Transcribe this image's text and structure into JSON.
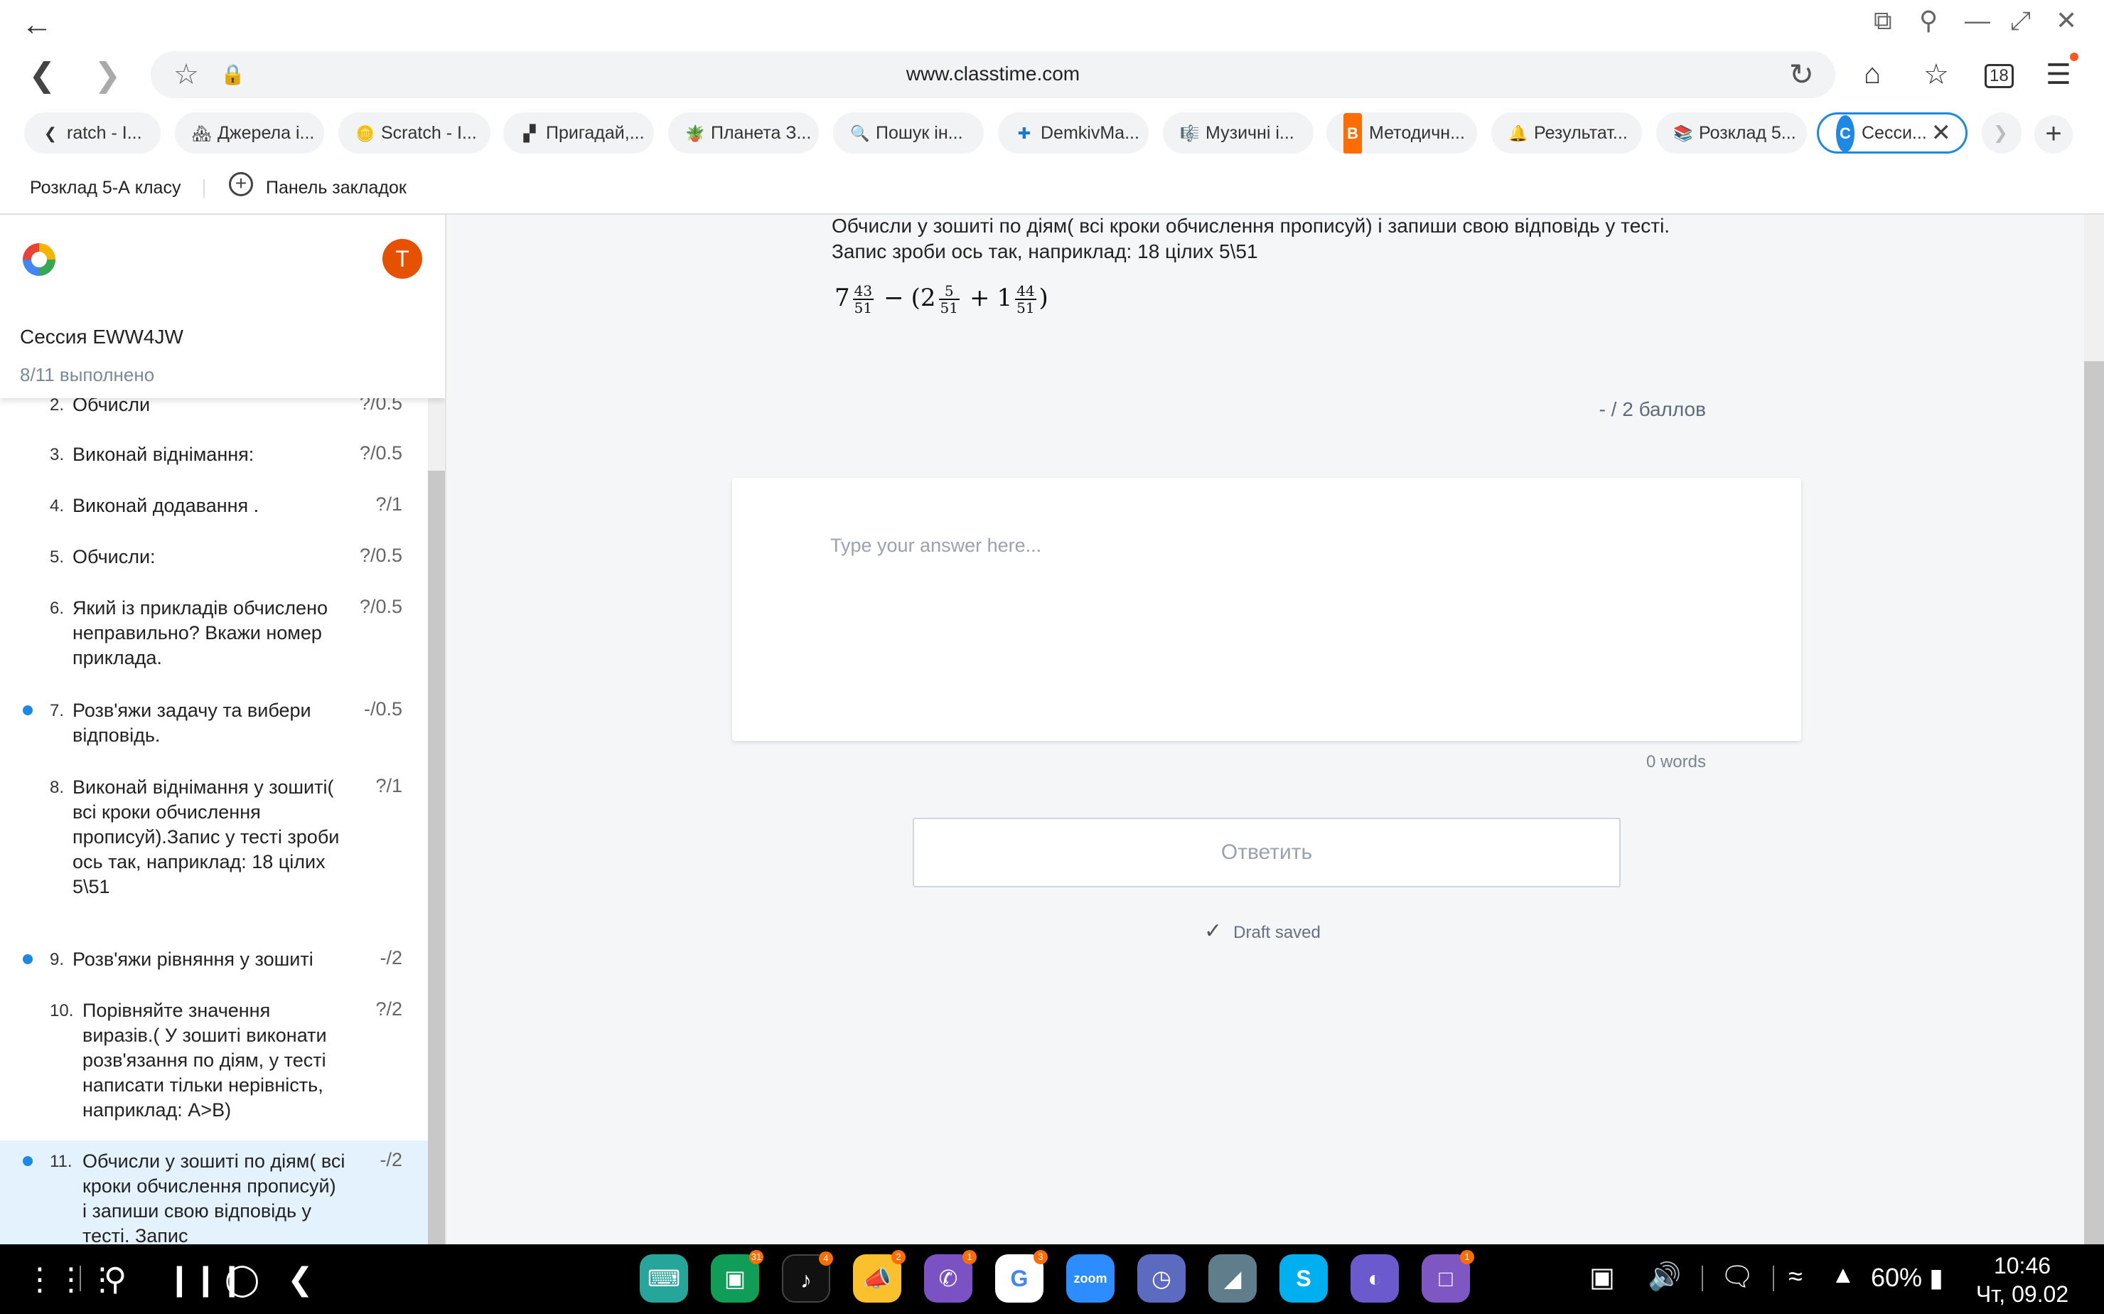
{
  "browser": {
    "url": "www.classtime.com",
    "tab_count": "18",
    "tabs": [
      {
        "label": "ratch - I...",
        "icon": "chevron-left"
      },
      {
        "label": "Джерела і...",
        "icon": "🏘"
      },
      {
        "label": "Scratch - I...",
        "icon": "🪙"
      },
      {
        "label": "Пригадай,...",
        "icon": "▞"
      },
      {
        "label": "Планета З...",
        "icon": "🪴"
      },
      {
        "label": "Пошук ін...",
        "icon": "🔍"
      },
      {
        "label": "DemkivMa...",
        "icon": "✚"
      },
      {
        "label": "Музичні і...",
        "icon": "🎼"
      },
      {
        "label": "Методичн...",
        "icon": "B"
      },
      {
        "label": "Результат...",
        "icon": "🔔"
      },
      {
        "label": "Розклад 5...",
        "icon": "📚"
      },
      {
        "label": "Сесси...",
        "icon": "C",
        "active": true
      }
    ],
    "bookmarks": {
      "item1": "Розклад 5-А класу",
      "panel": "Панель закладок"
    }
  },
  "sidebar": {
    "session": "Сессия EWW4JW",
    "progress": "8/11 выполнено",
    "avatar_letter": "T",
    "questions": [
      {
        "num": "2.",
        "text": "Обчисли",
        "score": "?/0.5",
        "dot": false
      },
      {
        "num": "3.",
        "text": "Виконай віднімання:",
        "score": "?/0.5",
        "dot": false
      },
      {
        "num": "4.",
        "text": "Виконай додавання .",
        "score": "?/1",
        "dot": false
      },
      {
        "num": "5.",
        "text": "Обчисли:",
        "score": "?/0.5",
        "dot": false
      },
      {
        "num": "6.",
        "text": "Який із прикладів обчислено неправильно? Вкажи номер приклада.",
        "score": "?/0.5",
        "dot": false
      },
      {
        "num": "7.",
        "text": "Розв'яжи задачу та вибери відповідь.",
        "score": "-/0.5",
        "dot": true
      },
      {
        "num": "8.",
        "text": "Виконай віднімання у зошиті( всі кроки обчислення прописуй).Запис у тесті зроби ось так, наприклад: 18 цілих 5\\51",
        "score": "?/1",
        "dot": false
      },
      {
        "num": "9.",
        "text": "Розв'яжи рівняння у зошиті",
        "score": "-/2",
        "dot": true
      },
      {
        "num": "10.",
        "text": "Порівняйте значення виразів.( У зошиті виконати розв'язання по діям, у тесті написати тільки нерівність, наприклад: A>B)",
        "score": "?/2",
        "dot": false
      },
      {
        "num": "11.",
        "text": "Обчисли у зошиті по діям( всі кроки обчислення прописуй) і запиши свою відповідь у тесті. Запис",
        "score": "-/2",
        "dot": true,
        "current": true
      }
    ]
  },
  "main": {
    "question_line1": "Обчисли у зошиті по діям( всі кроки обчислення прописуй) і запиши свою відповідь у тесті.",
    "question_line2": "Запис зроби ось так, наприклад: 18 цілих 5\\51",
    "formula": {
      "w1": "7",
      "n1": "43",
      "d1": "51",
      "minus": "−",
      "lparen": "(",
      "w2": "2",
      "n2": "5",
      "d2": "51",
      "plus": "+",
      "w3": "1",
      "n3": "44",
      "d3": "51",
      "rparen": ")"
    },
    "points": "- / 2 баллов",
    "answer_placeholder": "Type your answer here...",
    "answer_value": "",
    "word_count": "0 words",
    "submit_label": "Ответить",
    "draft_status": "Draft saved"
  },
  "system": {
    "battery": "60%",
    "time": "10:46",
    "date": "Чт, 09.02",
    "app_badges": {
      "classroom": "31",
      "tiktok": "4",
      "megaphone": "2",
      "viber": "1",
      "google": "3",
      "uklon": "1"
    }
  }
}
